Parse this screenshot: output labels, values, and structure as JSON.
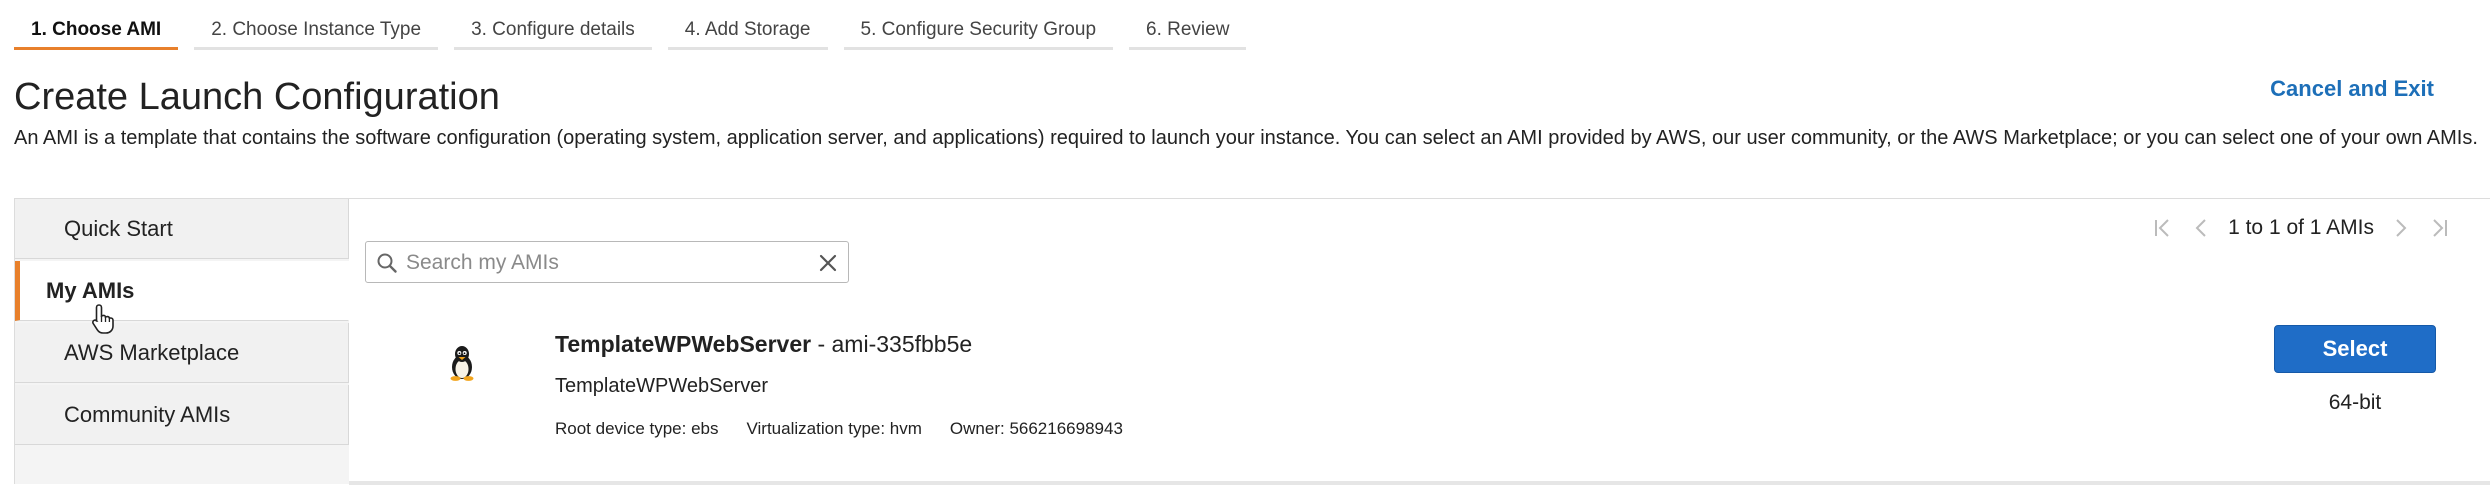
{
  "wizard": {
    "steps": [
      {
        "label": "1. Choose AMI",
        "active": true
      },
      {
        "label": "2. Choose Instance Type"
      },
      {
        "label": "3. Configure details"
      },
      {
        "label": "4. Add Storage"
      },
      {
        "label": "5. Configure Security Group"
      },
      {
        "label": "6. Review"
      }
    ]
  },
  "header": {
    "title": "Create Launch Configuration",
    "cancel_label": "Cancel and Exit",
    "description": "An AMI is a template that contains the software configuration (operating system, application server, and applications) required to launch your instance. You can select an AMI provided by AWS, our user community, or the AWS Marketplace; or you can select one of your own AMIs."
  },
  "sidebar": {
    "tabs": [
      {
        "label": "Quick Start"
      },
      {
        "label": "My AMIs",
        "active": true
      },
      {
        "label": "AWS Marketplace"
      },
      {
        "label": "Community AMIs"
      }
    ]
  },
  "search": {
    "placeholder": "Search my AMIs",
    "value": ""
  },
  "pager": {
    "text": "1 to 1 of 1 AMIs"
  },
  "ami": {
    "name": "TemplateWPWebServer",
    "id_text": " - ami-335fbb5e",
    "description": "TemplateWPWebServer",
    "root_device": "Root device type: ebs",
    "virtualization": "Virtualization type: hvm",
    "owner": "Owner: 566216698943",
    "select_label": "Select",
    "architecture": "64-bit",
    "os_icon": "linux-tux-icon"
  },
  "colors": {
    "accent_orange": "#e8802b",
    "link_blue": "#1d6fb8",
    "button_blue": "#1f6dc7"
  }
}
